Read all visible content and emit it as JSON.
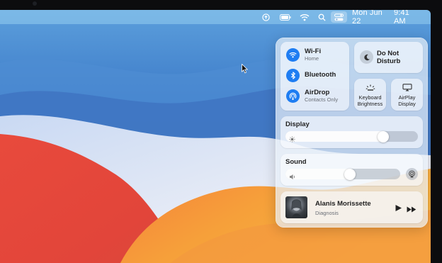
{
  "menubar": {
    "date": "Mon Jun 22",
    "time": "9:41 AM",
    "icons": [
      "upload-icon",
      "battery-icon",
      "wifi-icon",
      "search-icon",
      "control-center-icon"
    ]
  },
  "control_center": {
    "network": {
      "wifi": {
        "label": "Wi-Fi",
        "status": "Home",
        "icon": "wifi-icon",
        "enabled": true
      },
      "bluetooth": {
        "label": "Bluetooth",
        "icon": "bluetooth-icon",
        "enabled": true
      },
      "airdrop": {
        "label": "AirDrop",
        "status": "Contacts Only",
        "icon": "airdrop-icon",
        "enabled": true
      }
    },
    "do_not_disturb": {
      "label_line1": "Do Not",
      "label_line2": "Disturb",
      "icon": "moon-icon"
    },
    "keyboard_brightness": {
      "label_line1": "Keyboard",
      "label_line2": "Brightness",
      "icon": "keyboard-brightness-icon"
    },
    "airplay_display": {
      "label_line1": "AirPlay",
      "label_line2": "Display",
      "icon": "airplay-display-icon"
    },
    "display": {
      "title": "Display",
      "level": 0.74,
      "icon": "sun-icon"
    },
    "sound": {
      "title": "Sound",
      "level": 0.56,
      "icon": "speaker-icon"
    },
    "now_playing": {
      "title": "Alanis Morissette",
      "subtitle": "Diagnosis"
    }
  },
  "colors": {
    "accent": "#1e7df2",
    "panel": "#e8f0f8",
    "wallpaper_blue": "#4a8fd8",
    "wallpaper_red": "#e24a3a",
    "wallpaper_orange": "#f3a23a"
  }
}
